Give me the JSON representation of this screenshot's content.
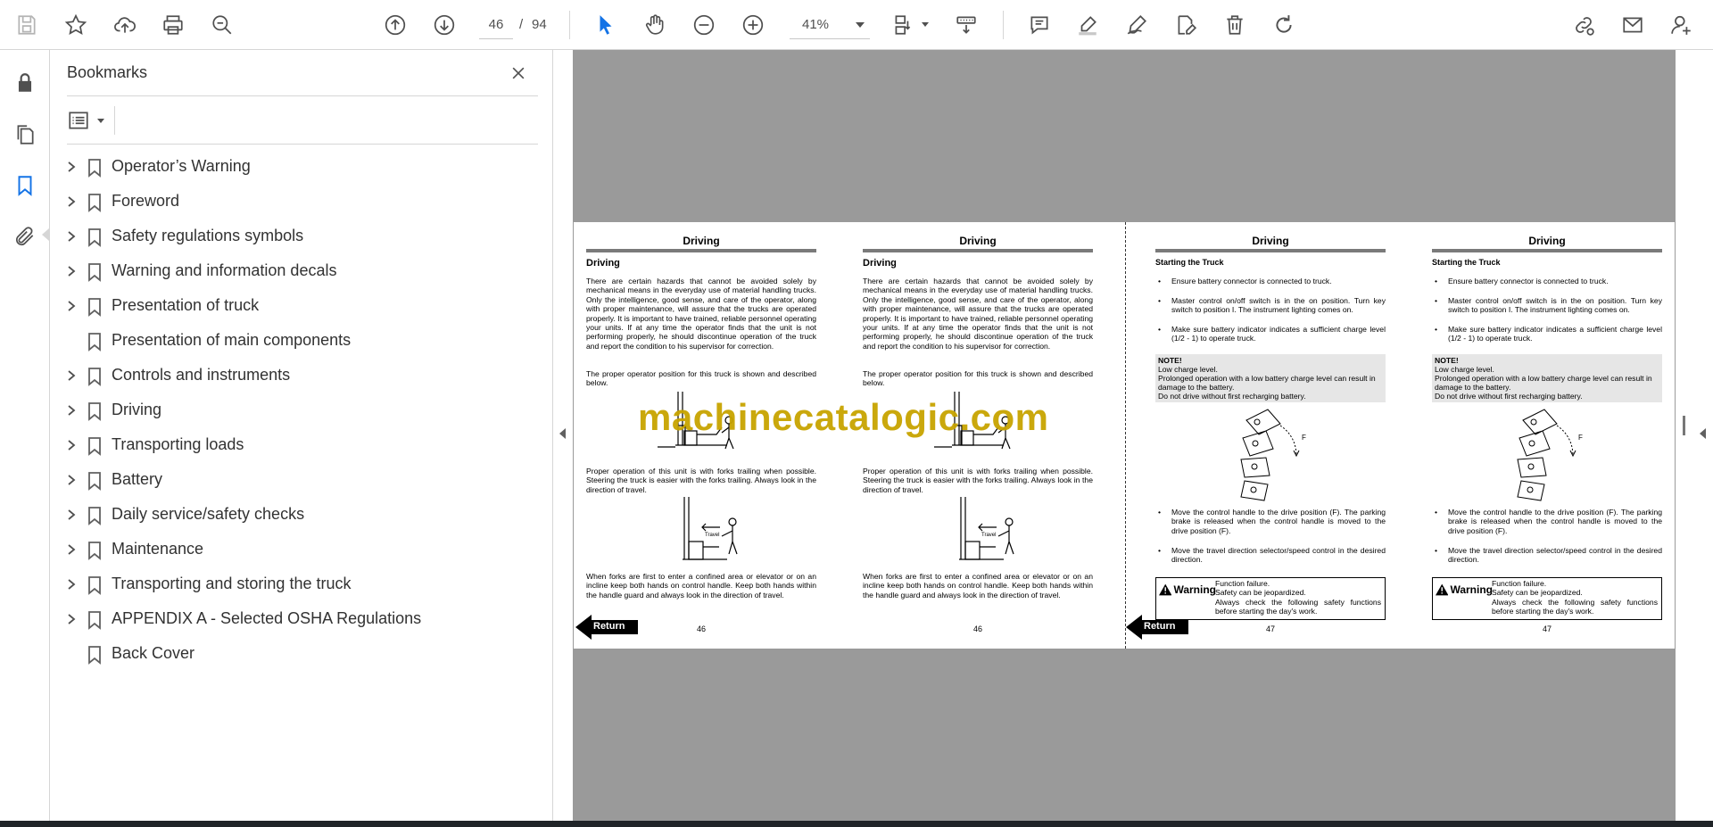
{
  "toolbar": {
    "current_page": "46",
    "page_separator": "/",
    "total_pages": "94",
    "zoom": "41%"
  },
  "bookmarks": {
    "title": "Bookmarks",
    "items": [
      {
        "label": "Operator’s Warning",
        "expandable": true
      },
      {
        "label": "Foreword",
        "expandable": true
      },
      {
        "label": "Safety regulations symbols",
        "expandable": true
      },
      {
        "label": "Warning and information decals",
        "expandable": true
      },
      {
        "label": "Presentation of truck",
        "expandable": true
      },
      {
        "label": "Presentation of main components",
        "expandable": false
      },
      {
        "label": "Controls and instruments",
        "expandable": true
      },
      {
        "label": "Driving",
        "expandable": true
      },
      {
        "label": "Transporting loads",
        "expandable": true
      },
      {
        "label": "Battery",
        "expandable": true
      },
      {
        "label": "Daily service/safety checks",
        "expandable": true
      },
      {
        "label": "Maintenance",
        "expandable": true
      },
      {
        "label": "Transporting and storing the truck",
        "expandable": true
      },
      {
        "label": "APPENDIX A - Selected OSHA Regulations",
        "expandable": true
      },
      {
        "label": "Back Cover",
        "expandable": false
      }
    ]
  },
  "document": {
    "watermark": "machinecatalogic.com",
    "return_label": "Return",
    "page46": {
      "header": "Driving",
      "subhead": "Driving",
      "para1": "There are certain hazards that cannot be avoided solely by mechanical means in the everyday use of material handling trucks. Only the intelligence, good sense, and care of the operator, along with proper maintenance, will assure that the trucks are operated properly. It is important to have trained, reliable personnel operating your units. If at any time the operator finds that the unit is not performing properly, he should discontinue operation of the truck and report the condition to his supervisor for correction.",
      "para2": "The proper operator position for this truck is shown and described below.",
      "para3": "Proper operation of this unit is with forks trailing when possible. Steering the truck is easier with the forks trailing. Always look in the direction of travel.",
      "para4": "When forks are first to enter a confined area or elevator or on an incline keep both hands on control handle. Keep both hands within the handle guard and always look in the direction of travel.",
      "figure_label": "Travel",
      "page_number": "46"
    },
    "page47": {
      "header": "Driving",
      "subhead": "Starting the Truck",
      "bullet1": "Ensure battery connector is connected to truck.",
      "bullet2": "Master control on/off switch is in the on position. Turn key switch to position I. The instrument lighting comes on.",
      "bullet3": "Make sure battery indicator indicates a sufficient charge level (1/2 - 1) to operate truck.",
      "note_title": "NOTE!",
      "note_line1": "Low charge level.",
      "note_line2": "Prolonged operation with a low battery charge level can result in damage to the battery.",
      "note_line3": "Do not drive without first recharging battery.",
      "figure_label": "F",
      "bullet4": "Move the control handle to the drive position (F). The parking brake is released when the control handle is moved to the drive position (F).",
      "bullet5": "Move the travel direction selector/speed control in the desired direction.",
      "warning_label": "Warning",
      "warning_line1": "Function failure.",
      "warning_line2": "Safety can be jeopardized.",
      "warning_line3": "Always check the following safety functions before starting the day's work.",
      "page_number": "47"
    }
  },
  "icons": {
    "toolbar": [
      "save-icon",
      "star-icon",
      "upload-cloud-icon",
      "print-icon",
      "zoom-search-icon",
      "page-up-icon",
      "page-down-icon",
      "select-cursor-icon",
      "hand-icon",
      "zoom-out-icon",
      "zoom-in-icon",
      "page-layout-icon",
      "scroll-mode-icon",
      "comment-icon",
      "highlight-icon",
      "draw-icon",
      "edit-pdf-icon",
      "delete-icon",
      "redo-icon",
      "share-link-icon",
      "mail-icon",
      "add-user-icon"
    ],
    "rail": [
      "lock-icon",
      "pages-icon",
      "bookmark-icon",
      "attachment-icon"
    ]
  },
  "colors": {
    "accent": "#1473e6",
    "watermark": "#c8a400",
    "doc_background": "#9a9a9a"
  }
}
